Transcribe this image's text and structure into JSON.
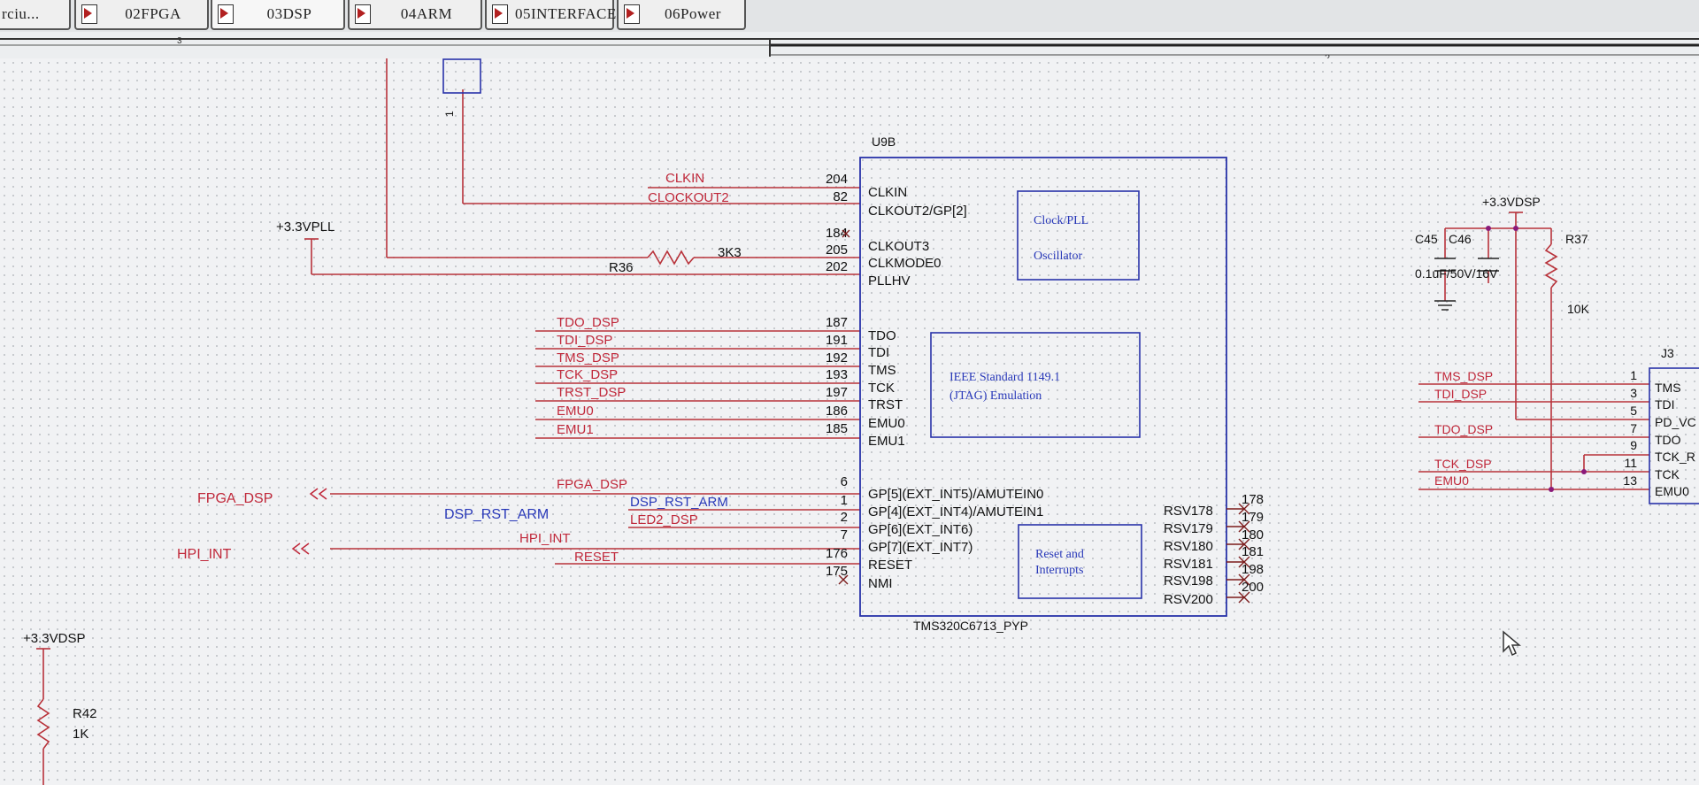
{
  "tabs": [
    {
      "label": "rciu..."
    },
    {
      "label": "02FPGA"
    },
    {
      "label": "03DSP"
    },
    {
      "label": "04ARM"
    },
    {
      "label": "05INTERFACE"
    },
    {
      "label": "06Power"
    }
  ],
  "ruler": {
    "zone_left": "3",
    "zone_right": "2"
  },
  "colors": {
    "wire": "#b8323a",
    "body": "#2832a8",
    "pin": "#7a1a1a",
    "label_red": "#c0283a",
    "label_blue": "#2838b8",
    "text": "#111111"
  },
  "u9b": {
    "designator": "U9B",
    "part": "TMS320C6713_PYP",
    "left_pins": [
      {
        "num": "204",
        "name": "CLKIN",
        "net": "CLKIN"
      },
      {
        "num": "82",
        "name": "CLKOUT2/GP[2]",
        "net": "CLOCKOUT2"
      },
      {
        "num": "184",
        "name": "",
        "net": ""
      },
      {
        "num": "205",
        "name": "CLKOUT3",
        "net": ""
      },
      {
        "num": "202",
        "name": "CLKMODE0",
        "net": ""
      },
      {
        "num": "",
        "name": "PLLHV",
        "net": ""
      },
      {
        "num": "187",
        "name": "TDO",
        "net": "TDO_DSP"
      },
      {
        "num": "191",
        "name": "TDI",
        "net": "TDI_DSP"
      },
      {
        "num": "192",
        "name": "TMS",
        "net": "TMS_DSP"
      },
      {
        "num": "193",
        "name": "TCK",
        "net": "TCK_DSP"
      },
      {
        "num": "197",
        "name": "TRST",
        "net": "TRST_DSP"
      },
      {
        "num": "186",
        "name": "EMU0",
        "net": "EMU0"
      },
      {
        "num": "185",
        "name": "EMU1",
        "net": "EMU1"
      },
      {
        "num": "6",
        "name": "GP[5](EXT_INT5)/AMUTEIN0",
        "net": "FPGA_DSP"
      },
      {
        "num": "1",
        "name": "GP[4](EXT_INT4)/AMUTEIN1",
        "net": "DSP_RST_ARM"
      },
      {
        "num": "2",
        "name": "GP[6](EXT_INT6)",
        "net": "LED2_DSP"
      },
      {
        "num": "7",
        "name": "GP[7](EXT_INT7)",
        "net": "HPI_INT"
      },
      {
        "num": "176",
        "name": "RESET",
        "net": "RESET"
      },
      {
        "num": "175",
        "name": "NMI",
        "net": ""
      }
    ],
    "right_pins": [
      {
        "num": "178",
        "name": "RSV178"
      },
      {
        "num": "179",
        "name": "RSV179"
      },
      {
        "num": "180",
        "name": "RSV180"
      },
      {
        "num": "181",
        "name": "RSV181"
      },
      {
        "num": "198",
        "name": "RSV198"
      },
      {
        "num": "200",
        "name": "RSV200"
      }
    ],
    "blocks": [
      {
        "line1": "Clock/PLL",
        "line2": "Oscillator"
      },
      {
        "line1": "IEEE Standard 1149.1",
        "line2": "(JTAG) Emulation"
      },
      {
        "line1": "Reset and",
        "line2": "Interrupts"
      }
    ]
  },
  "testpoint_pin": "1",
  "pll": {
    "power": "+3.3VPLL",
    "resistor": "R36",
    "value": "3K3"
  },
  "offsheet": {
    "fpga": "FPGA_DSP",
    "hpi": "HPI_INT",
    "dsp_rst": "DSP_RST_ARM"
  },
  "r42": {
    "power": "+3.3VDSP",
    "designator": "R42",
    "value": "1K"
  },
  "right_block": {
    "power": "+3.3VDSP",
    "c45": "C45",
    "c46": "C46",
    "cap_values": "0.1uF/50V/16V",
    "r37": "R37",
    "r37_value": "10K",
    "j3": "J3",
    "j3_pins": [
      {
        "num": "1",
        "name": "TMS",
        "net": "TMS_DSP"
      },
      {
        "num": "3",
        "name": "TDI",
        "net": "TDI_DSP"
      },
      {
        "num": "5",
        "name": "PD_VC",
        "net": ""
      },
      {
        "num": "7",
        "name": "TDO",
        "net": "TDO_DSP"
      },
      {
        "num": "9",
        "name": "TCK_R",
        "net": ""
      },
      {
        "num": "11",
        "name": "TCK",
        "net": "TCK_DSP"
      },
      {
        "num": "13",
        "name": "EMU0",
        "net": "EMU0"
      }
    ]
  }
}
